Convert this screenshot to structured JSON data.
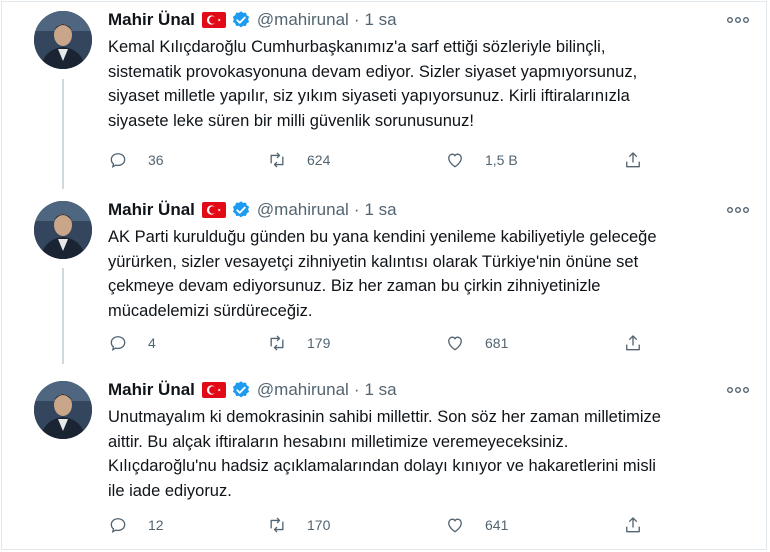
{
  "tweets": [
    {
      "name": "Mahir Ünal",
      "handle": "@mahirunal",
      "separator": "·",
      "time": "1 sa",
      "lines": [
        "Kemal Kılıçdaroğlu Cumhurbaşkanımız'a sarf ettiği  sözleriyle bilinçli,",
        "sistematik provokasyonuna devam ediyor. Sizler siyaset yapmıyorsunuz,",
        "siyaset milletle yapılır, siz yıkım siyaseti yapıyorsunuz. Kirli iftiralarınızla",
        "siyasete leke süren bir milli güvenlik sorunusunuz!"
      ],
      "replies": "36",
      "retweets": "624",
      "likes": "1,5 B"
    },
    {
      "name": "Mahir Ünal",
      "handle": "@mahirunal",
      "separator": "·",
      "time": "1 sa",
      "lines": [
        "AK Parti kurulduğu günden bu yana kendini yenileme kabiliyetiyle geleceğe",
        "yürürken, sizler vesayetçi zihniyetin kalıntısı olarak Türkiye'nin önüne set",
        "çekmeye devam ediyorsunuz. Biz her zaman bu çirkin zihniyetinizle",
        "mücadelemizi sürdüreceğiz."
      ],
      "replies": "4",
      "retweets": "179",
      "likes": "681"
    },
    {
      "name": "Mahir Ünal",
      "handle": "@mahirunal",
      "separator": "·",
      "time": "1 sa",
      "lines": [
        "Unutmayalım ki demokrasinin sahibi millettir. Son söz her zaman milletimize",
        "aittir. Bu alçak iftiraların hesabını milletimize veremeyeceksiniz.",
        "Kılıçdaroğlu'nu hadsiz açıklamalarından dolayı kınıyor ve hakaretlerini misli",
        "ile iade ediyoruz."
      ],
      "replies": "12",
      "retweets": "170",
      "likes": "641"
    }
  ],
  "colors": {
    "verified": "#1d9bf0",
    "flag": "#e30a17",
    "muted": "#536471",
    "thread_line": "#cfd9de"
  },
  "icons": [
    "reply-icon",
    "retweet-icon",
    "like-icon",
    "share-icon",
    "more-icon",
    "verified-badge-icon",
    "turkey-flag-icon"
  ]
}
